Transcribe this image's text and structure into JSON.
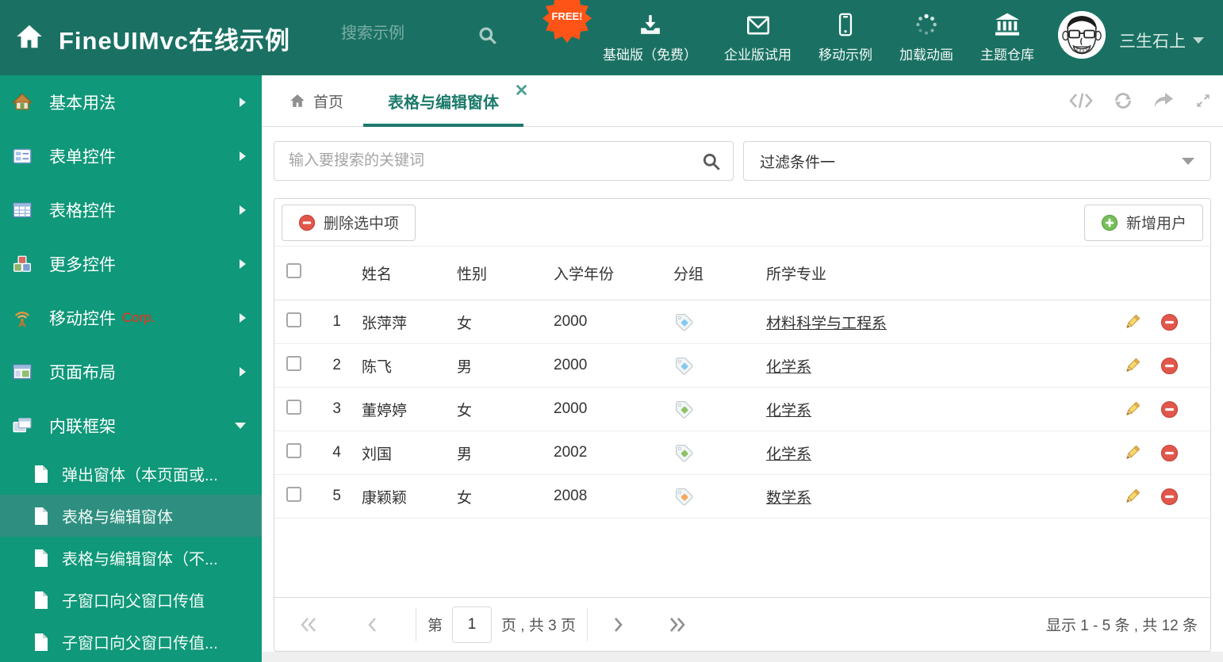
{
  "colors": {
    "header_bg": "#1A7163",
    "sidebar_bg": "#0F9879",
    "sidebar_selected_bg": "#2E8F80",
    "accent_teal": "#1C7A6B",
    "free_badge_orange": "#FF5417",
    "delete_red": "#E2574C",
    "add_green": "#76BF5A",
    "tag_blue": "#85C8F0",
    "tag_green": "#8CC164",
    "tag_orange": "#F5A95C"
  },
  "header": {
    "title": "FineUIMvc在线示例",
    "search_placeholder": "搜索示例",
    "free_badge": "FREE!",
    "menu": [
      {
        "label": "基础版（免费）",
        "icon": "download-icon"
      },
      {
        "label": "企业版试用",
        "icon": "envelope-icon"
      },
      {
        "label": "移动示例",
        "icon": "mobile-icon"
      },
      {
        "label": "加载动画",
        "icon": "spinner-icon"
      },
      {
        "label": "主题仓库",
        "icon": "bank-icon"
      }
    ],
    "username": "三生石上"
  },
  "sidebar": {
    "items": [
      {
        "label": "基本用法",
        "icon": "home-icon"
      },
      {
        "label": "表单控件",
        "icon": "form-icon"
      },
      {
        "label": "表格控件",
        "icon": "table-icon"
      },
      {
        "label": "更多控件",
        "icon": "cubes-icon"
      },
      {
        "label": "移动控件",
        "badge": "Corp.",
        "icon": "antenna-icon"
      },
      {
        "label": "页面布局",
        "icon": "layout-icon"
      },
      {
        "label": "内联框架",
        "icon": "frames-icon"
      }
    ],
    "subitems": [
      {
        "label": "弹出窗体（本页面或..."
      },
      {
        "label": "表格与编辑窗体"
      },
      {
        "label": "表格与编辑窗体（不..."
      },
      {
        "label": "子窗口向父窗口传值"
      },
      {
        "label": "子窗口向父窗口传值..."
      }
    ]
  },
  "tabs": {
    "home_label": "首页",
    "active_label": "表格与编辑窗体"
  },
  "filters": {
    "search_placeholder": "输入要搜索的关键词",
    "filter_value": "过滤条件一"
  },
  "toolbar": {
    "delete_label": "删除选中项",
    "add_label": "新增用户"
  },
  "table": {
    "headers": {
      "name": "姓名",
      "gender": "性别",
      "year": "入学年份",
      "group": "分组",
      "major": "所学专业"
    },
    "rows": [
      {
        "num": "1",
        "name": "张萍萍",
        "gender": "女",
        "year": "2000",
        "tag_color": "#85C8F0",
        "major": "材料科学与工程系"
      },
      {
        "num": "2",
        "name": "陈飞",
        "gender": "男",
        "year": "2000",
        "tag_color": "#85C8F0",
        "major": "化学系"
      },
      {
        "num": "3",
        "name": "董婷婷",
        "gender": "女",
        "year": "2000",
        "tag_color": "#8CC164",
        "major": "化学系"
      },
      {
        "num": "4",
        "name": "刘国",
        "gender": "男",
        "year": "2002",
        "tag_color": "#8CC164",
        "major": "化学系"
      },
      {
        "num": "5",
        "name": "康颖颖",
        "gender": "女",
        "year": "2008",
        "tag_color": "#F5A95C",
        "major": "数学系"
      }
    ]
  },
  "pagination": {
    "prefix": "第",
    "current": "1",
    "suffix": "页 , 共 3 页",
    "summary": "显示 1 - 5 条 , 共 12 条"
  }
}
